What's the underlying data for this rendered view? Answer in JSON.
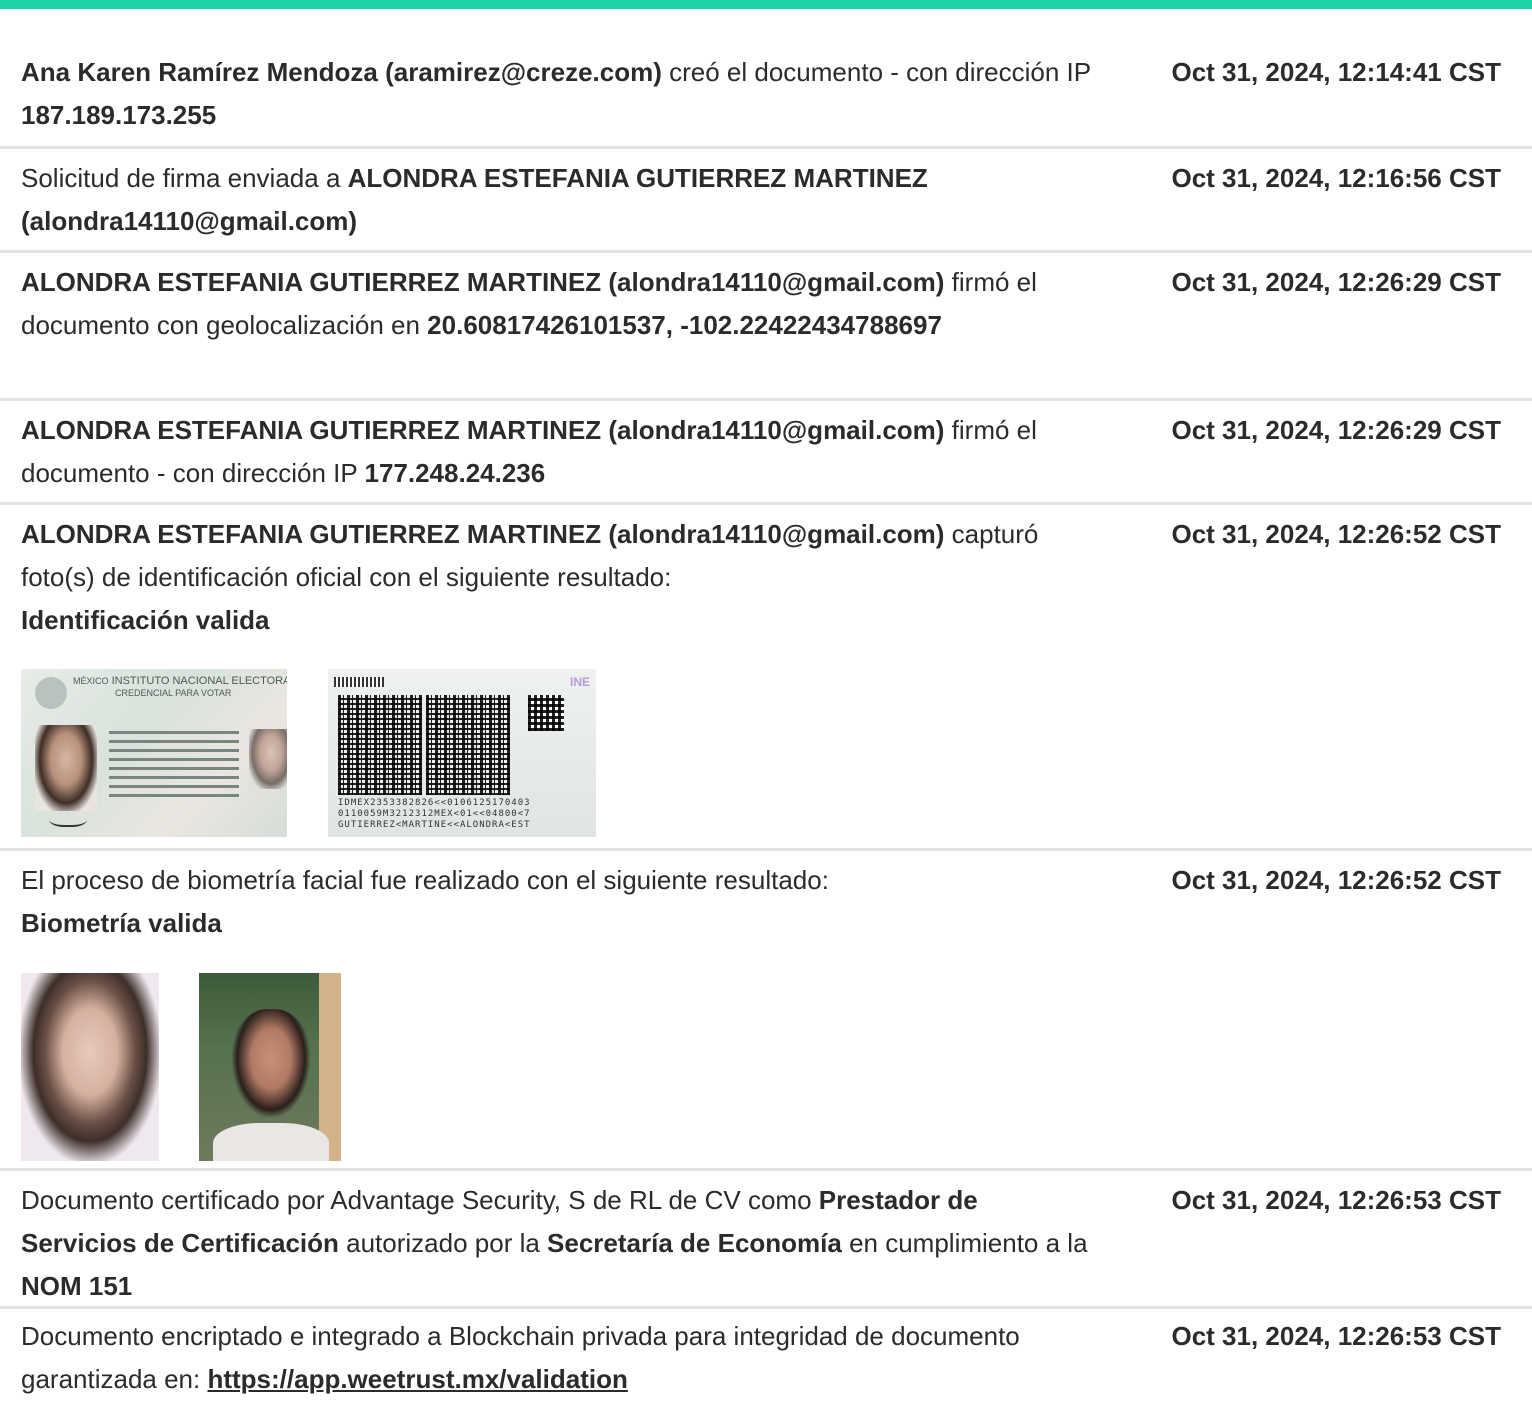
{
  "colors": {
    "accent": "#1ed3a8",
    "divider": "#e3e4e8",
    "text": "#2b2b2b"
  },
  "entries": [
    {
      "desc": [
        {
          "t": "Ana Karen Ramírez Mendoza (aramirez@creze.com)",
          "b": true
        },
        {
          "t": " creó el documento - con dirección IP "
        },
        {
          "t": "187.189.173.255",
          "b": true
        }
      ],
      "time": "Oct 31, 2024, 12:14:41 CST"
    },
    {
      "desc": [
        {
          "t": "Solicitud de firma enviada a "
        },
        {
          "t": "ALONDRA ESTEFANIA GUTIERREZ MARTINEZ (alondra14110@gmail.com)",
          "b": true
        }
      ],
      "time": "Oct 31, 2024, 12:16:56 CST"
    },
    {
      "desc": [
        {
          "t": "ALONDRA ESTEFANIA GUTIERREZ MARTINEZ (alondra14110@gmail.com)",
          "b": true
        },
        {
          "t": " firmó el documento con geolocalización en "
        },
        {
          "t": "20.60817426101537, -102.22422434788697",
          "b": true
        }
      ],
      "time": "Oct 31, 2024, 12:26:29 CST"
    },
    {
      "desc": [
        {
          "t": "ALONDRA ESTEFANIA GUTIERREZ MARTINEZ (alondra14110@gmail.com)",
          "b": true
        },
        {
          "t": " firmó el documento - con dirección IP "
        },
        {
          "t": "177.248.24.236",
          "b": true
        }
      ],
      "time": "Oct 31, 2024, 12:26:29 CST"
    },
    {
      "desc": [
        {
          "t": "ALONDRA ESTEFANIA GUTIERREZ MARTINEZ (alondra14110@gmail.com)",
          "b": true
        },
        {
          "t": " capturó foto(s) de identificación oficial con el siguiente resultado: "
        },
        {
          "t": "Identificación valida",
          "b": true,
          "br": true
        }
      ],
      "time": "Oct 31, 2024, 12:26:52 CST",
      "id_card": {
        "front_header": [
          "MÉXICO",
          "INSTITUTO NACIONAL ELECTORAL",
          "CREDENCIAL PARA VOTAR"
        ],
        "back_logo": "INE",
        "mrz": [
          "IDMEX2353382826<<0106125170403",
          "0110059M3212312MEX<01<<04800<7",
          "GUTIERREZ<MARTINE<<ALONDRA<EST"
        ]
      }
    },
    {
      "desc": [
        {
          "t": "El proceso de biometría facial fue realizado con el siguiente resultado: "
        },
        {
          "t": "Biometría valida",
          "b": true,
          "br": true
        }
      ],
      "time": "Oct 31, 2024, 12:26:52 CST"
    },
    {
      "desc": [
        {
          "t": "Documento certificado por Advantage Security, S de RL de CV como "
        },
        {
          "t": "Prestador de Servicios de Certificación",
          "b": true
        },
        {
          "t": " autorizado por la "
        },
        {
          "t": "Secretaría de Economía",
          "b": true
        },
        {
          "t": " en cumplimiento a la "
        },
        {
          "t": "NOM 151",
          "b": true
        }
      ],
      "time": "Oct 31, 2024, 12:26:53 CST"
    },
    {
      "desc": [
        {
          "t": "Documento encriptado e integrado a Blockchain privada para integridad de documento garantizada en: "
        },
        {
          "t": "https://app.weetrust.mx/validation",
          "link": true
        }
      ],
      "time": "Oct 31, 2024, 12:26:53 CST"
    }
  ]
}
